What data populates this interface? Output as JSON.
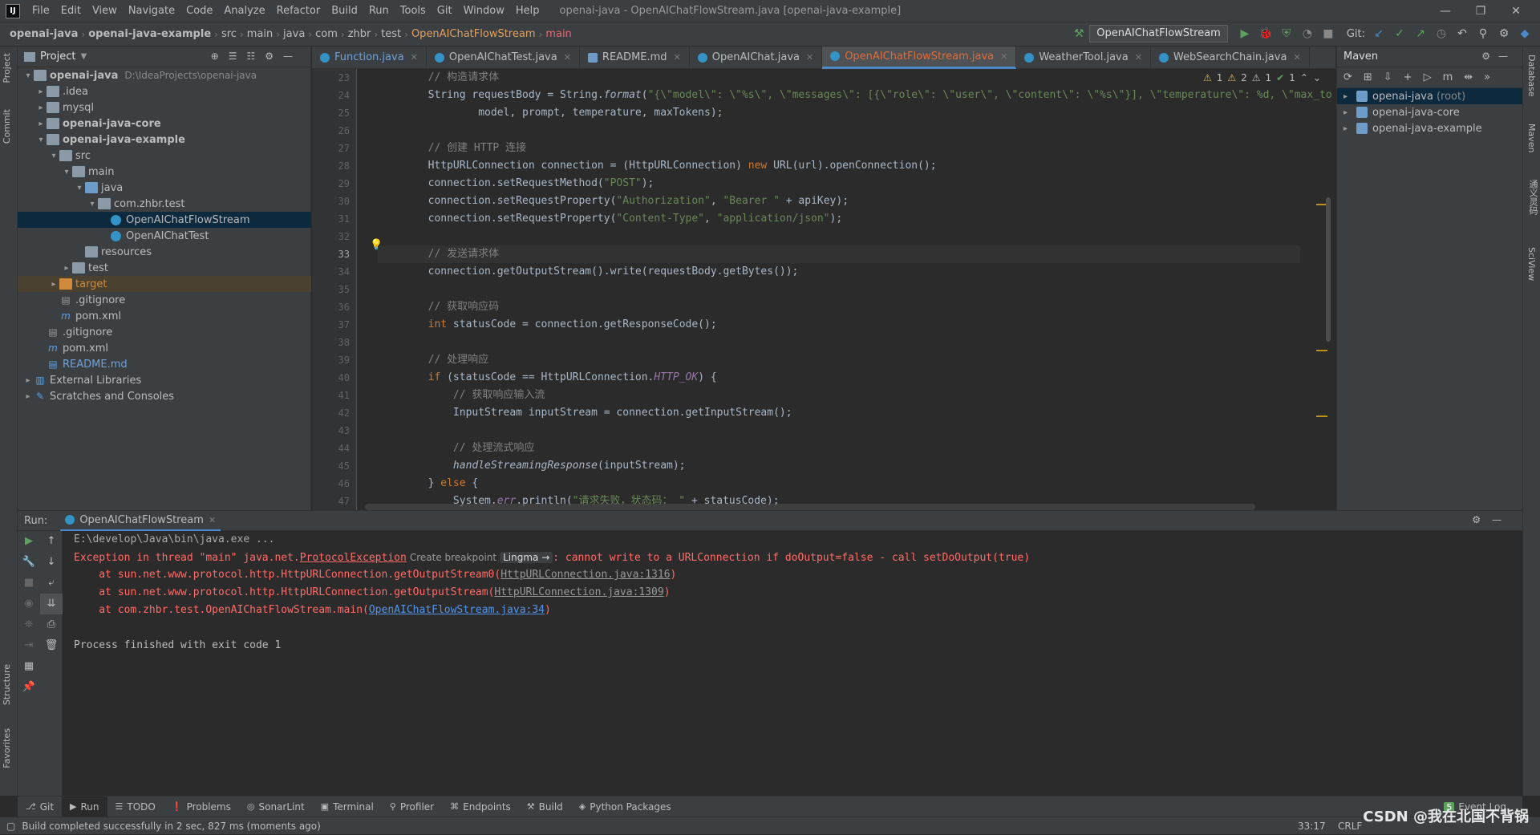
{
  "menubar": {
    "items": [
      "File",
      "Edit",
      "View",
      "Navigate",
      "Code",
      "Analyze",
      "Refactor",
      "Build",
      "Run",
      "Tools",
      "Git",
      "Window",
      "Help"
    ],
    "window_title": "openai-java - OpenAIChatFlowStream.java [openai-java-example]"
  },
  "breadcrumb": {
    "items": [
      "openai-java",
      "openai-java-example",
      "src",
      "main",
      "java",
      "com",
      "zhbr",
      "test",
      "OpenAIChatFlowStream",
      "main"
    ]
  },
  "toolbar": {
    "run_config": "OpenAIChatFlowStream",
    "git_label": "Git:"
  },
  "left_strip": {
    "project": "Project",
    "commit": "Commit",
    "structure": "Structure",
    "favorites": "Favorites"
  },
  "right_strip": {
    "database": "Database",
    "maven": "Maven",
    "tongyi": "通义灵码",
    "sciview": "SciView"
  },
  "project": {
    "title": "Project",
    "tree": [
      {
        "label": "openai-java",
        "hint": "D:\\IdeaProjects\\openai-java",
        "depth": 0,
        "arrow": "v",
        "icon": "folder",
        "bold": true
      },
      {
        "label": ".idea",
        "depth": 1,
        "arrow": ">",
        "icon": "folder"
      },
      {
        "label": "mysql",
        "depth": 1,
        "arrow": ">",
        "icon": "folder"
      },
      {
        "label": "openai-java-core",
        "depth": 1,
        "arrow": ">",
        "icon": "folder",
        "bold": true
      },
      {
        "label": "openai-java-example",
        "depth": 1,
        "arrow": "v",
        "icon": "folder",
        "bold": true
      },
      {
        "label": "src",
        "depth": 2,
        "arrow": "v",
        "icon": "folder"
      },
      {
        "label": "main",
        "depth": 3,
        "arrow": "v",
        "icon": "folder"
      },
      {
        "label": "java",
        "depth": 4,
        "arrow": "v",
        "icon": "folder-blue"
      },
      {
        "label": "com.zhbr.test",
        "depth": 5,
        "arrow": "v",
        "icon": "folder"
      },
      {
        "label": "OpenAIChatFlowStream",
        "depth": 6,
        "arrow": "",
        "icon": "class",
        "selected": true
      },
      {
        "label": "OpenAIChatTest",
        "depth": 6,
        "arrow": "",
        "icon": "class"
      },
      {
        "label": "resources",
        "depth": 4,
        "arrow": "",
        "icon": "folder"
      },
      {
        "label": "test",
        "depth": 3,
        "arrow": ">",
        "icon": "folder"
      },
      {
        "label": "target",
        "depth": 2,
        "arrow": ">",
        "icon": "folder-orange",
        "excluded": true
      },
      {
        "label": ".gitignore",
        "depth": 2,
        "arrow": "",
        "icon": "file"
      },
      {
        "label": "pom.xml",
        "depth": 2,
        "arrow": "",
        "icon": "maven"
      },
      {
        "label": ".gitignore",
        "depth": 1,
        "arrow": "",
        "icon": "file"
      },
      {
        "label": "pom.xml",
        "depth": 1,
        "arrow": "",
        "icon": "maven"
      },
      {
        "label": "README.md",
        "depth": 1,
        "arrow": "",
        "icon": "md",
        "blue": true
      },
      {
        "label": "External Libraries",
        "depth": 0,
        "arrow": ">",
        "icon": "lib"
      },
      {
        "label": "Scratches and Consoles",
        "depth": 0,
        "arrow": ">",
        "icon": "scratch"
      }
    ]
  },
  "tabs": [
    {
      "label": "Function.java",
      "kind": "func"
    },
    {
      "label": "OpenAIChatTest.java",
      "kind": "class"
    },
    {
      "label": "README.md",
      "kind": "md"
    },
    {
      "label": "OpenAIChat.java",
      "kind": "class"
    },
    {
      "label": "OpenAIChatFlowStream.java",
      "kind": "class",
      "active": true
    },
    {
      "label": "WeatherTool.java",
      "kind": "class"
    },
    {
      "label": "WebSearchChain.java",
      "kind": "class"
    }
  ],
  "inspections": {
    "warn1": "1",
    "warn2": "2",
    "weak": "1",
    "ok": "1"
  },
  "editor": {
    "current_line": 33,
    "lines": [
      {
        "n": 23,
        "html": "        <span class='cm'>// 构造请求体</span>"
      },
      {
        "n": 24,
        "html": "        String requestBody = String.<span class='it'>format</span>(<span class='str'>\"{\\\"model\\\": \\\"%s\\\", \\\"messages\\\": [{\\\"role\\\": \\\"user\\\", \\\"content\\\": \\\"%s\\\"}], \\\"temperature\\\": %d, \\\"max_to</span>"
      },
      {
        "n": 25,
        "html": "                model, prompt, temperature, maxTokens);"
      },
      {
        "n": 26,
        "html": ""
      },
      {
        "n": 27,
        "html": "        <span class='cm'>// 创建 HTTP 连接</span>"
      },
      {
        "n": 28,
        "html": "        HttpURLConnection connection = (HttpURLConnection) <span class='kw'>new</span> URL(url).openConnection();"
      },
      {
        "n": 29,
        "html": "        connection.setRequestMethod(<span class='str'>\"POST\"</span>);"
      },
      {
        "n": 30,
        "html": "        connection.setRequestProperty(<span class='str'>\"Authorization\"</span>, <span class='str'>\"Bearer \"</span> + apiKey);"
      },
      {
        "n": 31,
        "html": "        connection.setRequestProperty(<span class='str'>\"Content-Type\"</span>, <span class='str'>\"application/json\"</span>);"
      },
      {
        "n": 32,
        "html": ""
      },
      {
        "n": 33,
        "html": "        <span class='cm'>// 发送请求体</span>"
      },
      {
        "n": 34,
        "html": "        connection.getOutputStream().write(requestBody.getBytes());"
      },
      {
        "n": 35,
        "html": ""
      },
      {
        "n": 36,
        "html": "        <span class='cm'>// 获取响应码</span>"
      },
      {
        "n": 37,
        "html": "        <span class='kw'>int</span> statusCode = connection.getResponseCode();"
      },
      {
        "n": 38,
        "html": ""
      },
      {
        "n": 39,
        "html": "        <span class='cm'>// 处理响应</span>"
      },
      {
        "n": 40,
        "html": "        <span class='kw'>if</span> (statusCode == HttpURLConnection.<span class='stc'>HTTP_OK</span>) {"
      },
      {
        "n": 41,
        "html": "            <span class='cm'>// 获取响应输入流</span>"
      },
      {
        "n": 42,
        "html": "            InputStream inputStream = connection.getInputStream();"
      },
      {
        "n": 43,
        "html": ""
      },
      {
        "n": 44,
        "html": "            <span class='cm'>// 处理流式响应</span>"
      },
      {
        "n": 45,
        "html": "            <span class='it'>handleStreamingResponse</span>(inputStream);"
      },
      {
        "n": 46,
        "html": "        } <span class='kw'>else</span> {"
      },
      {
        "n": 47,
        "html": "            System.<span class='err it'>err</span>.println(<span class='str'>\"请求失败，状态码： \"</span> + statusCode);"
      }
    ]
  },
  "maven": {
    "title": "Maven",
    "nodes": [
      {
        "label": "openai-java",
        "hint": "(root)",
        "selected": true
      },
      {
        "label": "openai-java-core"
      },
      {
        "label": "openai-java-example"
      }
    ]
  },
  "run": {
    "label": "Run:",
    "tab": "OpenAIChatFlowStream",
    "console": {
      "cmd": "E:\\develop\\Java\\bin\\java.exe ...",
      "exc_prefix": "Exception in thread \"main\" java.net.",
      "exc_class": "ProtocolException",
      "create_bp": "Create breakpoint",
      "lingma": "Lingma →",
      "exc_msg": ": cannot write to a URLConnection if doOutput=false - call setDoOutput(true)",
      "st1_pre": "    at sun.net.www.protocol.http.HttpURLConnection.getOutputStream0(",
      "st1_link": "HttpURLConnection.java:1316",
      "st2_pre": "    at sun.net.www.protocol.http.HttpURLConnection.getOutputStream(",
      "st2_link": "HttpURLConnection.java:1309",
      "st3_pre": "    at com.zhbr.test.OpenAIChatFlowStream.main(",
      "st3_link": "OpenAIChatFlowStream.java:34",
      "close": ")",
      "finished": "Process finished with exit code 1"
    }
  },
  "bottom_tabs": [
    {
      "label": "Git",
      "icon": "⎇"
    },
    {
      "label": "Run",
      "icon": "▶",
      "active": true
    },
    {
      "label": "TODO",
      "icon": "☰"
    },
    {
      "label": "Problems",
      "icon": "❗"
    },
    {
      "label": "SonarLint",
      "icon": "◎"
    },
    {
      "label": "Terminal",
      "icon": "▣"
    },
    {
      "label": "Profiler",
      "icon": "⚲"
    },
    {
      "label": "Endpoints",
      "icon": "⌘"
    },
    {
      "label": "Build",
      "icon": "⚒"
    },
    {
      "label": "Python Packages",
      "icon": "◈"
    }
  ],
  "event_log": "Event Log",
  "event_log_badge": "5",
  "status": {
    "message": "Build completed successfully in 2 sec, 827 ms (moments ago)",
    "position": "33:17",
    "line_sep": "CRLF",
    "watermark": "CSDN @我在北国不背锅"
  }
}
